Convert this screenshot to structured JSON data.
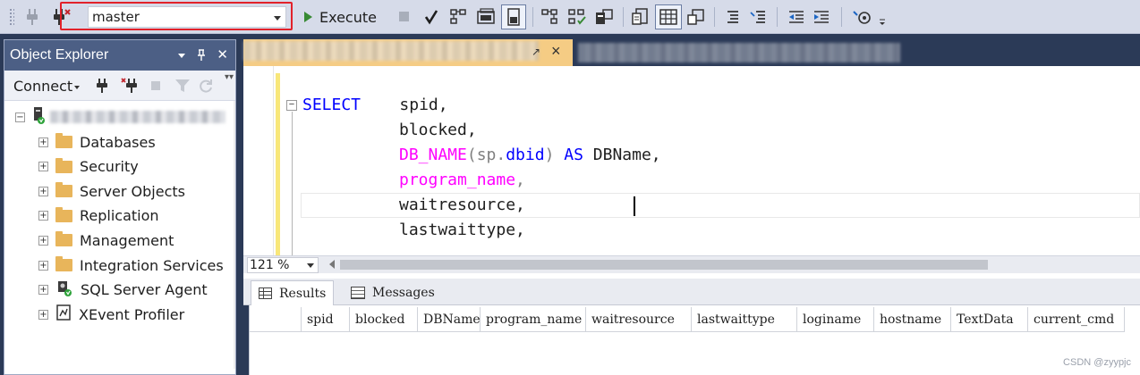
{
  "toolbar": {
    "database": "master",
    "execute_label": "Execute"
  },
  "object_explorer": {
    "title": "Object Explorer",
    "connect_label": "Connect",
    "pin_glyph": "↓",
    "pushpin_glyph": "†",
    "close_glyph": "✕",
    "tree": [
      {
        "label": "Databases",
        "icon": "folder-icon"
      },
      {
        "label": "Security",
        "icon": "folder-icon"
      },
      {
        "label": "Server Objects",
        "icon": "folder-icon"
      },
      {
        "label": "Replication",
        "icon": "folder-icon"
      },
      {
        "label": "Management",
        "icon": "folder-icon"
      },
      {
        "label": "Integration Services",
        "icon": "folder-icon"
      },
      {
        "label": "SQL Server Agent",
        "icon": "sql-agent-icon"
      },
      {
        "label": "XEvent Profiler",
        "icon": "xevent-profiler-icon"
      }
    ]
  },
  "editor": {
    "lines": [
      {
        "kw": "SELECT",
        "rest": "spid,"
      },
      {
        "rest": "blocked,"
      },
      {
        "fn": "DB_NAME",
        "rest_a": "(sp.",
        "kw2": "dbid",
        "rest_b": ") ",
        "kw3": "AS",
        "rest_c": " DBName,"
      },
      {
        "fn": "program_name",
        "rest": ","
      },
      {
        "rest": "waitresource,"
      },
      {
        "rest": "lastwaittype,"
      }
    ],
    "zoom": "121 %"
  },
  "results": {
    "tab_results": "Results",
    "tab_messages": "Messages",
    "columns": [
      "spid",
      "blocked",
      "DBName",
      "program_name",
      "waitresource",
      "lastwaittype",
      "loginame",
      "hostname",
      "TextData",
      "current_cmd"
    ]
  },
  "watermark": "CSDN @zyypjc"
}
